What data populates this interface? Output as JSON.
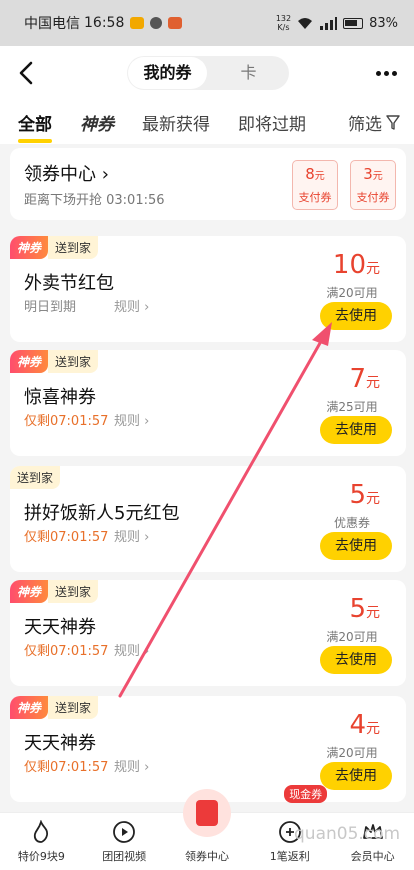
{
  "status_bar": {
    "carrier": "中国电信",
    "time": "16:58",
    "speed_value": "132",
    "speed_unit": "K/s",
    "battery": "83%"
  },
  "nav": {
    "seg_my": "我的券",
    "seg_card": "卡"
  },
  "tabs": [
    "全部",
    "神券",
    "最新获得",
    "即将过期",
    "筛选"
  ],
  "center": {
    "title": "领券中心",
    "subtitle": "距离下场开抢 03:01:56",
    "coupons": [
      {
        "value": "8",
        "unit": "元",
        "label": "支付券"
      },
      {
        "value": "3",
        "unit": "元",
        "label": "支付券"
      }
    ]
  },
  "coupons": [
    {
      "shen": "神券",
      "home": "送到家",
      "name": "外卖节红包",
      "expire": "明日到期",
      "rule": "规则",
      "value": "10",
      "unit": "元",
      "cond": "满20可用",
      "btn": "去使用"
    },
    {
      "shen": "神券",
      "home": "送到家",
      "name": "惊喜神券",
      "expire": "仅剩07:01:57",
      "rule": "规则",
      "value": "7",
      "unit": "元",
      "cond": "满25可用",
      "btn": "去使用"
    },
    {
      "shen": "",
      "home": "送到家",
      "name": "拼好饭新人5元红包",
      "expire": "仅剩07:01:57",
      "rule": "规则",
      "value": "5",
      "unit": "元",
      "cond": "优惠券",
      "btn": "去使用"
    },
    {
      "shen": "神券",
      "home": "送到家",
      "name": "天天神券",
      "expire": "仅剩07:01:57",
      "rule": "规则",
      "value": "5",
      "unit": "元",
      "cond": "满20可用",
      "btn": "去使用"
    },
    {
      "shen": "神券",
      "home": "送到家",
      "name": "天天神券",
      "expire": "仅剩07:01:57",
      "rule": "规则",
      "value": "4",
      "unit": "元",
      "cond": "满20可用",
      "btn": "去使用"
    }
  ],
  "bottom": {
    "items": [
      "特价9块9",
      "团团视频",
      "领券中心",
      "1笔返利",
      "会员中心"
    ],
    "cash_tag": "现金券"
  },
  "watermark": "quan05.com",
  "colors": {
    "accent": "#ffd100",
    "price": "#e8432f",
    "arrow": "#f0506e"
  }
}
